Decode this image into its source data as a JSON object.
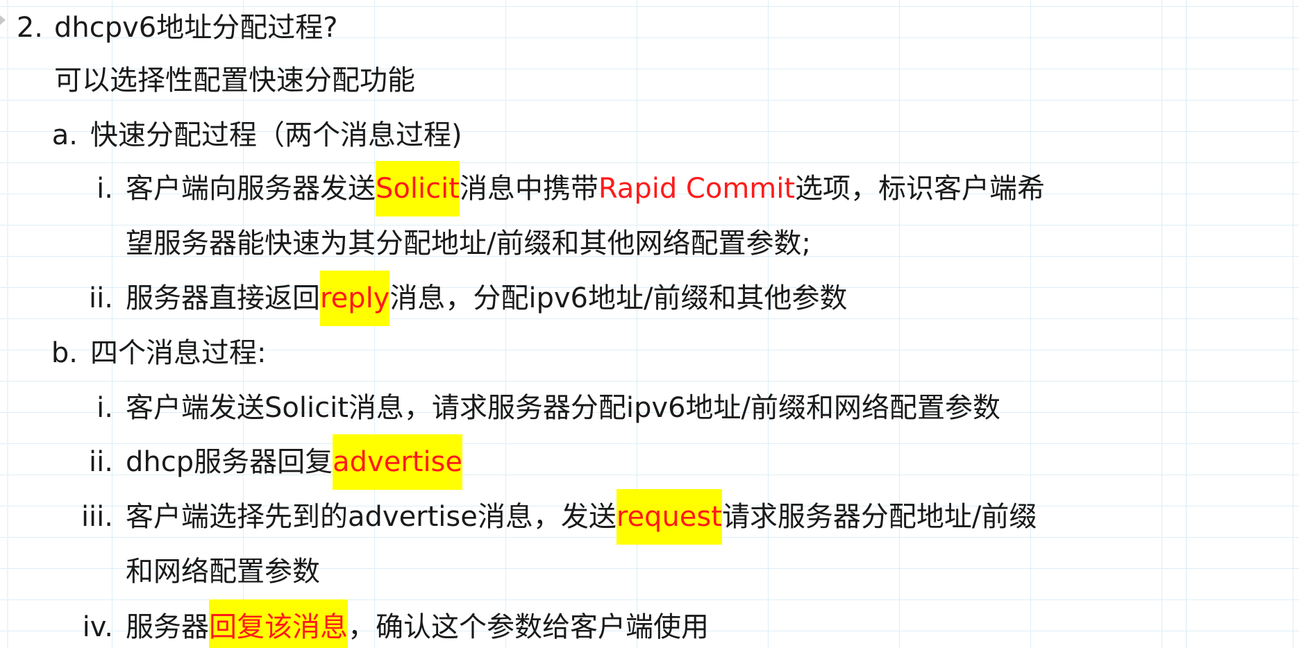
{
  "lines": [
    {
      "marker": "2.",
      "segments": [
        {
          "text": "dhcpv6地址分配过程?"
        }
      ]
    },
    {
      "marker": "",
      "segments": [
        {
          "text": "可以选择性配置快速分配功能"
        }
      ]
    },
    {
      "marker": "a.",
      "segments": [
        {
          "text": "快速分配过程（两个消息过程)"
        }
      ]
    },
    {
      "marker": "i.",
      "segments": [
        {
          "text": "客户端向服务器发送"
        },
        {
          "text": "Solicit",
          "highlight": true
        },
        {
          "text": "消息中携带"
        },
        {
          "text": "Rapid Commit",
          "red": true
        },
        {
          "text": "选项，标识客户端希"
        }
      ]
    },
    {
      "marker": "",
      "segments": [
        {
          "text": "望服务器能快速为其分配地址/前缀和其他网络配置参数;"
        }
      ]
    },
    {
      "marker": "ii.",
      "segments": [
        {
          "text": "服务器直接返回"
        },
        {
          "text": "reply",
          "highlight": true
        },
        {
          "text": "消息，分配ipv6地址/前缀和其他参数"
        }
      ]
    },
    {
      "marker": "b.",
      "segments": [
        {
          "text": "四个消息过程:"
        }
      ]
    },
    {
      "marker": "i.",
      "segments": [
        {
          "text": "客户端发送Solicit消息，请求服务器分配ipv6地址/前缀和网络配置参数"
        }
      ]
    },
    {
      "marker": "ii.",
      "segments": [
        {
          "text": "dhcp服务器回复"
        },
        {
          "text": "advertise",
          "highlight": true
        }
      ]
    },
    {
      "marker": "iii.",
      "segments": [
        {
          "text": "客户端选择先到的advertise消息，发送"
        },
        {
          "text": "request",
          "highlight": true
        },
        {
          "text": "请求服务器分配地址/前缀"
        }
      ]
    },
    {
      "marker": "",
      "segments": [
        {
          "text": "和网络配置参数"
        }
      ]
    },
    {
      "marker": "iv.",
      "segments": [
        {
          "text": "服务器"
        },
        {
          "text": "回复该消息",
          "highlight": true
        },
        {
          "text": "，确认这个参数给客户端使用"
        }
      ]
    }
  ]
}
